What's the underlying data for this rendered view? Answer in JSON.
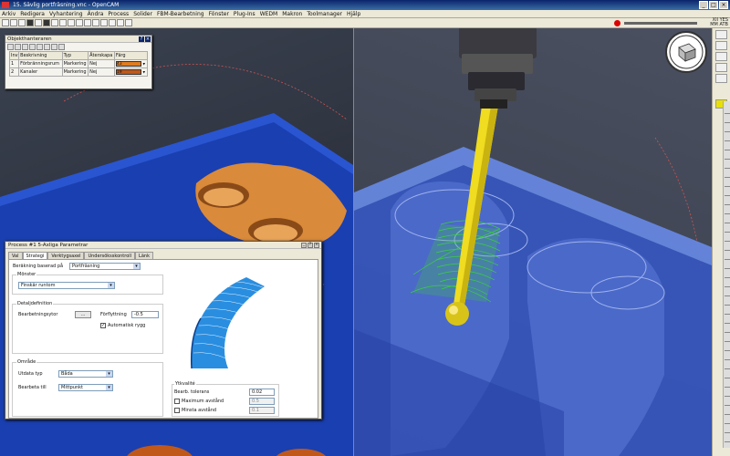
{
  "window": {
    "title": "15. Sävlig portfräsning.vnc - OpenCAM"
  },
  "menu": [
    "Arkiv",
    "Redigera",
    "Vyhantering",
    "Ändra",
    "Process",
    "Solider",
    "FBM-Bearbetning",
    "Fönster",
    "Plug-Ins",
    "WEDM",
    "Makron",
    "Toolmanager",
    "Hjälp"
  ],
  "toolbar": {
    "coord_top": "XII",
    "coord_mid": "MM",
    "coord_val": "YES",
    "coord_bot": "ATB"
  },
  "object_manager": {
    "title": "Objekthanteraren",
    "headers": [
      "Inv",
      "Beskrivning",
      "Typ",
      "Återskapa",
      "Färg"
    ],
    "rows": [
      {
        "nr": "1",
        "desc": "Förbränningsrum",
        "type": "Markering",
        "recreate": "Nej",
        "color_label": "43",
        "color": "#e07b20"
      },
      {
        "nr": "2",
        "desc": "Kanaler",
        "type": "Markering",
        "recreate": "Nej",
        "color_label": "19",
        "color": "#c0581a"
      }
    ]
  },
  "process_dialog": {
    "title": "Process #1 5-Axliga Parametrar",
    "tabs": [
      "Val",
      "Strategi",
      "Verktygsaxel",
      "Undersöksskontroll",
      "Länk"
    ],
    "active_tab": "Strategi",
    "calc_label": "Beräkning baserad på",
    "calc_value": "Portfräsning",
    "pattern_group": "Mönster",
    "pattern_value": "Finskär runtom",
    "detail_group": "Detaljdefinition",
    "surfaces_label": "Bearbetningsytor",
    "surfaces_btn": "...",
    "offset_label": "Förflyttning",
    "offset_value": "-0.5",
    "auto_chain_label": "Automatisk rygg",
    "auto_chain_checked": "✓",
    "area_group": "Område",
    "output_label": "Utdata typ",
    "output_value": "Båda",
    "process_to_label": "Bearbeta till",
    "process_to_value": "Mittpunkt",
    "surface_quality_group": "Ytkvalité",
    "tolerance_label": "Bearb. tolerans",
    "tolerance_value": "0.02",
    "max_dist_label": "Maximum avstånd",
    "max_dist_value": "0.5",
    "min_dist_label": "Minsta avstånd",
    "min_dist_value": "0.1"
  },
  "colors": {
    "workpiece_blue": "#1a3fb0",
    "chamber_copper": "#d98a3a",
    "tool_yellow": "#f0dc20",
    "toolpath_green": "#3ccf3c",
    "preview_blue": "#2a8ee0"
  },
  "icons": [
    "stop-icon",
    "viewcube-icon",
    "close-icon",
    "help-icon"
  ]
}
